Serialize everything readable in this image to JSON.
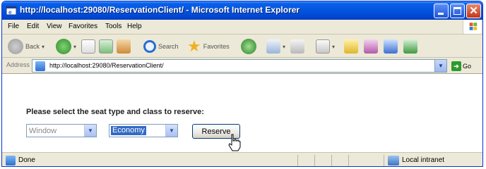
{
  "window": {
    "title": "http://localhost:29080/ReservationClient/ - Microsoft Internet Explorer",
    "controls": {
      "minimize": "minimize",
      "maximize": "maximize",
      "close": "✕"
    }
  },
  "menu": [
    "File",
    "Edit",
    "View",
    "Favorites",
    "Tools",
    "Help"
  ],
  "toolbar": {
    "back_label": "Back",
    "search_label": "Search",
    "favorites_label": "Favorites"
  },
  "address": {
    "label": "Address",
    "url": "http://localhost:29080/ReservationClient/",
    "go_label": "Go"
  },
  "form": {
    "prompt": "Please select the seat type and class to reserve:",
    "seat_type_value": "Window",
    "class_value": "Economy",
    "reserve_label": "Reserve"
  },
  "status": {
    "text": "Done",
    "zone": "Local intranet"
  },
  "colors": {
    "titlebar": "#0455de",
    "selection": "#316ac5",
    "chrome": "#ece9d8"
  }
}
